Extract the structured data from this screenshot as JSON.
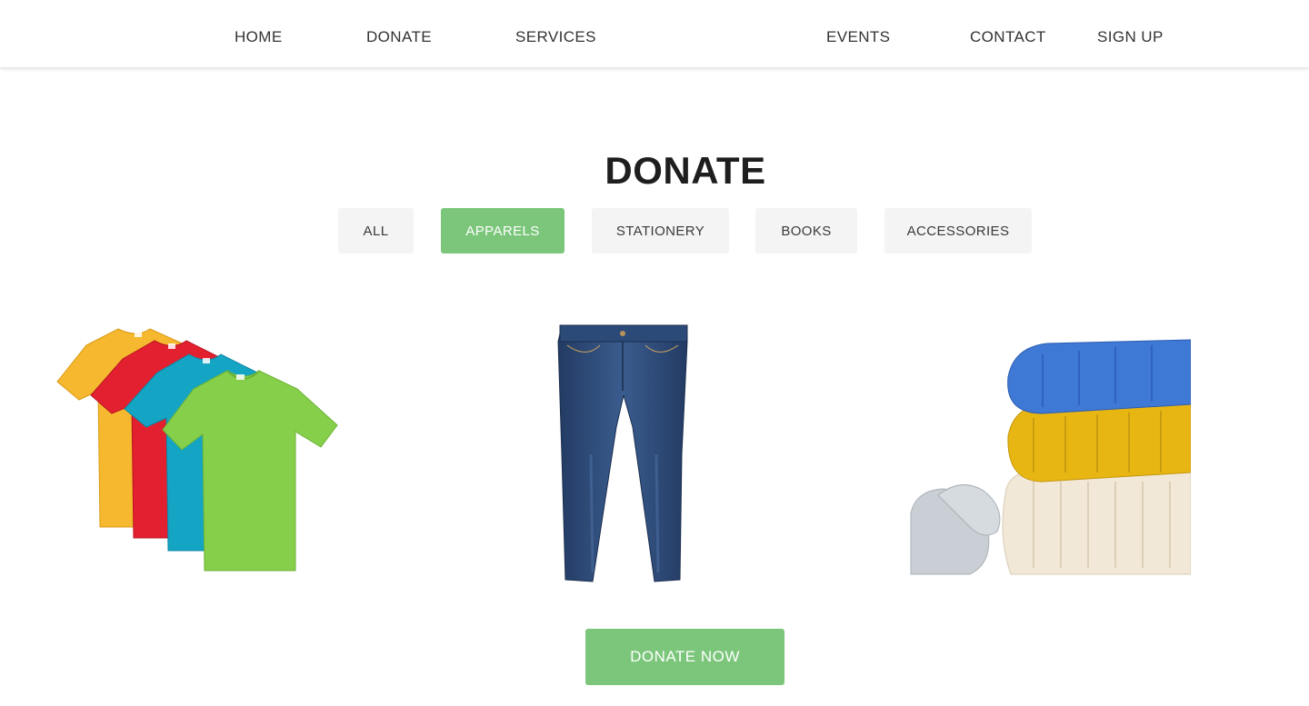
{
  "nav": {
    "home": "HOME",
    "donate": "DONATE",
    "services": "SERVICES",
    "events": "EVENTS",
    "contact": "CONTACT",
    "signup": "SIGN UP"
  },
  "page_title": "DONATE",
  "filters": {
    "all": "ALL",
    "apparels": "APPARELS",
    "stationery": "STATIONERY",
    "books": "BOOKS",
    "accessories": "ACCESSORIES",
    "active": "APPARELS"
  },
  "products": [
    {
      "name": "tshirts-image"
    },
    {
      "name": "jeans-image"
    },
    {
      "name": "sweaters-image"
    }
  ],
  "cta": {
    "label": "DONATE NOW"
  },
  "colors": {
    "accent": "#7bc67b",
    "filter_bg": "#f4f4f4",
    "text_dark": "#1e1e1e"
  }
}
